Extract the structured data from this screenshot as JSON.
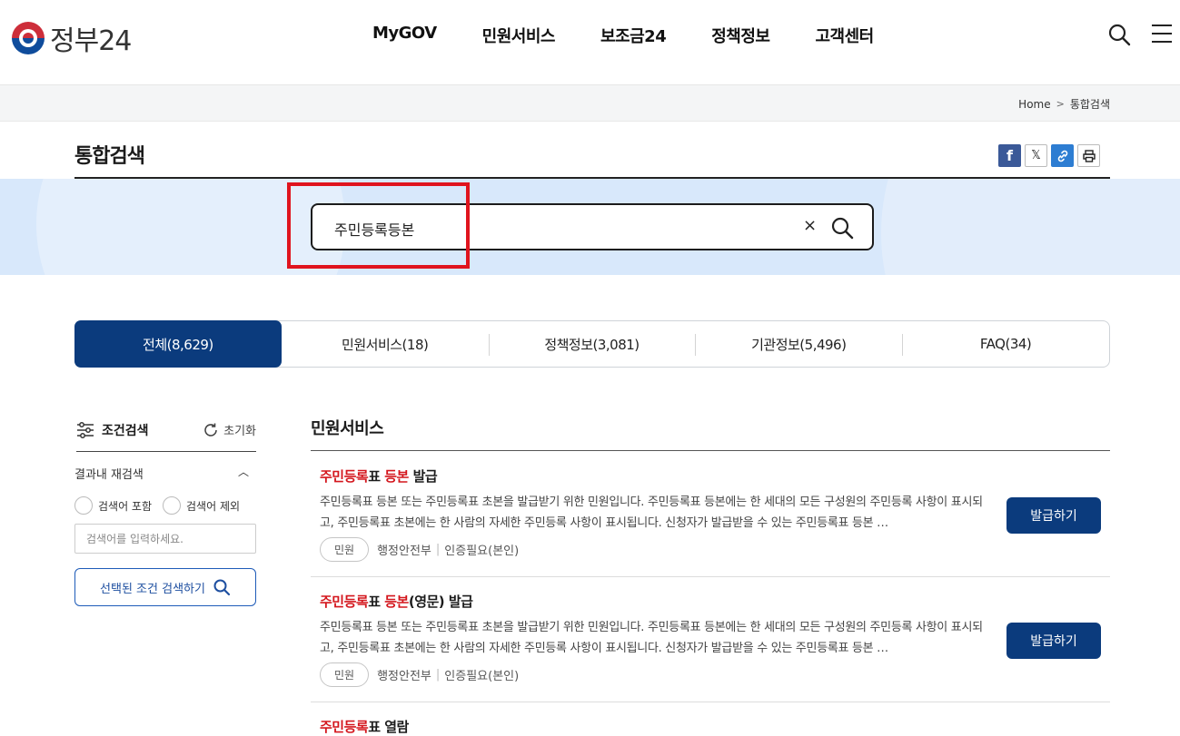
{
  "header": {
    "logo_text": "정부24",
    "nav": [
      "MyGOV",
      "민원서비스",
      "보조금24",
      "정책정보",
      "고객센터"
    ]
  },
  "breadcrumb": {
    "home": "Home",
    "separator": ">",
    "current": "통합검색"
  },
  "page": {
    "title": "통합검색"
  },
  "search": {
    "value": "주민등록등본",
    "clear_symbol": "×"
  },
  "tabs": [
    "전체(8,629)",
    "민원서비스(18)",
    "정책정보(3,081)",
    "기관정보(5,496)",
    "FAQ(34)"
  ],
  "filter": {
    "title": "조건검색",
    "reset_label": "초기화",
    "refine_label": "결과내 재검색",
    "toggle_symbol": "︿",
    "radio_include": "검색어 포함",
    "radio_exclude": "검색어 제외",
    "input_placeholder": "검색어를 입력하세요.",
    "apply_label": "선택된 조건 검색하기"
  },
  "results_section": {
    "title": "민원서비스",
    "items": [
      {
        "title_hl1": "주민등록",
        "title_mid": "표 ",
        "title_hl2": "등본",
        "title_rest": " 발급",
        "description": "주민등록표 등본 또는 주민등록표 초본을 발급받기 위한 민원입니다. 주민등록표 등본에는 한 세대의 모든 구성원의 주민등록 사항이 표시되고, 주민등록표 초본에는 한 사람의 자세한 주민등록 사항이 표시됩니다. 신청자가 발급받을 수 있는 주민등록표 등본 …",
        "badge": "민원",
        "agency": "행정안전부",
        "auth": "인증필요(본인)",
        "button": "발급하기"
      },
      {
        "title_hl1": "주민등록",
        "title_mid": "표 ",
        "title_hl2": "등본",
        "title_rest": "(영문) 발급",
        "description": "주민등록표 등본 또는 주민등록표 초본을 발급받기 위한 민원입니다. 주민등록표 등본에는 한 세대의 모든 구성원의 주민등록 사항이 표시되고, 주민등록표 초본에는 한 사람의 자세한 주민등록 사항이 표시됩니다. 신청자가 발급받을 수 있는 주민등록표 등본 …",
        "badge": "민원",
        "agency": "행정안전부",
        "auth": "인증필요(본인)",
        "button": "발급하기"
      },
      {
        "title_hl1": "주민등록",
        "title_mid": "표 열람",
        "title_hl2": "",
        "title_rest": ""
      }
    ]
  },
  "colors": {
    "primary": "#0b3b7d",
    "highlight": "#d4161d",
    "band": "#d8e8fb",
    "annotation": "#e0141e"
  }
}
